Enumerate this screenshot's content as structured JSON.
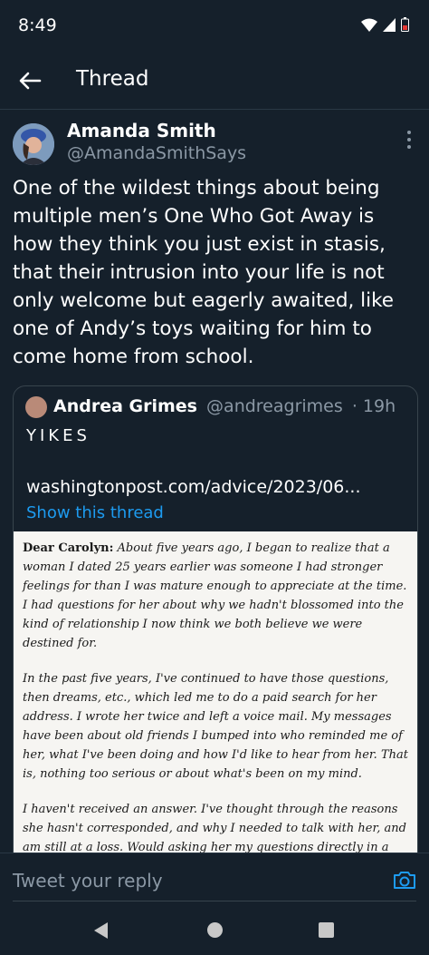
{
  "status_bar": {
    "time": "8:49"
  },
  "app_bar": {
    "title": "Thread"
  },
  "tweet": {
    "author_name": "Amanda Smith",
    "author_handle": "@AmandaSmithSays",
    "text": "One of the wildest things about being multiple men’s One Who Got Away is how they think you just exist in stasis, that their intrusion into your life is not only welcome but eagerly awaited, like one of Andy’s toys waiting for him to come home from school."
  },
  "quoted_tweet": {
    "author_name": "Andrea Grimes",
    "author_handle": "@andreagrimes",
    "time": "· 19h",
    "text": "YIKES",
    "link": "washingtonpost.com/advice/2023/06...",
    "show_thread": "Show this thread",
    "clipping": {
      "p1_bold": "Dear Carolyn:",
      "p1": " About five years ago, I began to realize that a woman I dated 25 years earlier was someone I had stronger feelings for than I was mature enough to appreciate at the time. I had questions for her about why we hadn't blossomed into the kind of relationship I now think we both believe we were destined for.",
      "p2": "In the past five years, I've continued to have those questions, then dreams, etc., which led me to do a paid search for her address. I wrote her twice and left a voice mail. My messages have been about old friends I bumped into who reminded me of her, what I've been doing and how I'd like to hear from her. That is, nothing too serious or about what's been on my mind.",
      "p3": "I haven't received an answer. I've thought through the reasons she hasn't corresponded, and why I needed to talk with her, and am still at a loss. Would asking her my questions directly in a letter be a way to coax her to reconnect? Telling her that, apart from this midlife crisis of"
    }
  },
  "reply": {
    "placeholder": "Tweet your reply"
  },
  "colors": {
    "background": "#15202b",
    "accent": "#1d9bf0",
    "muted": "#8b98a5"
  }
}
